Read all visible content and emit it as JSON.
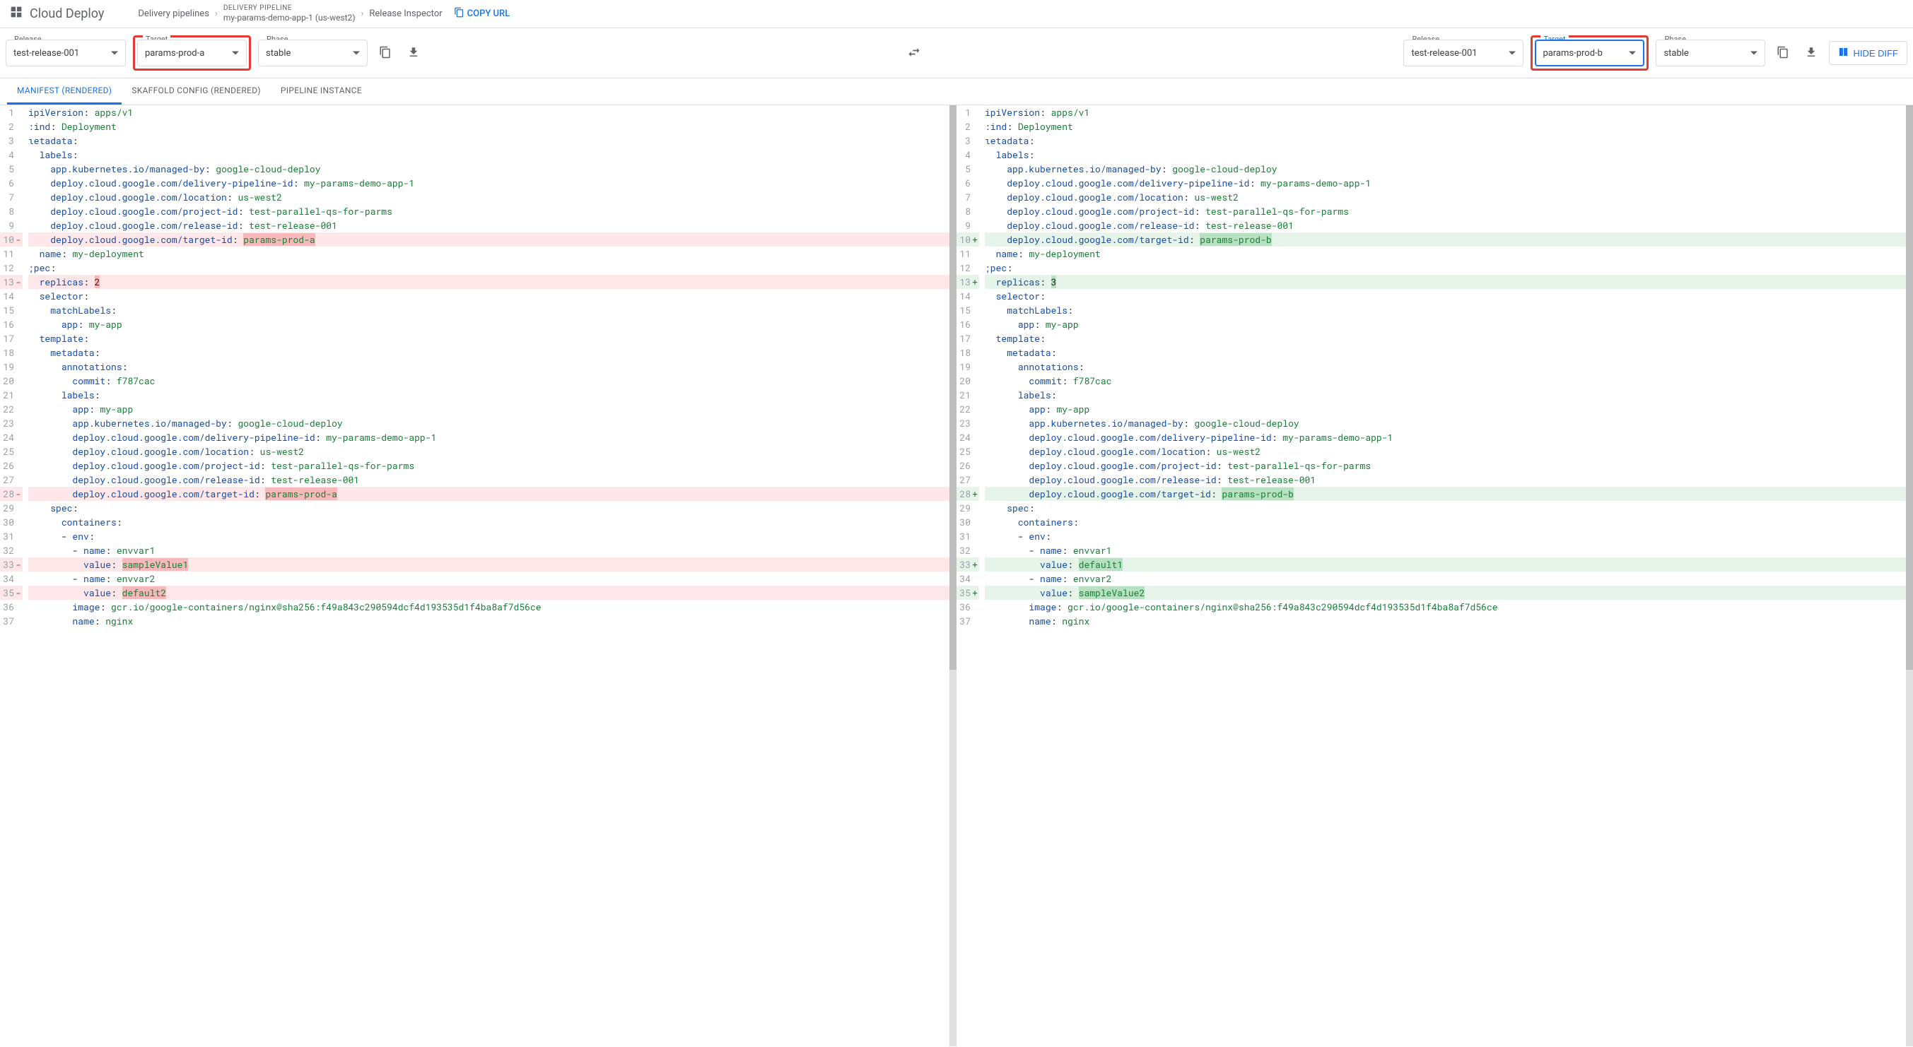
{
  "header": {
    "product": "Cloud Deploy",
    "crumb1": "Delivery pipelines",
    "pipeline_label": "DELIVERY PIPELINE",
    "pipeline_value": "my-params-demo-app-1 (us-west2)",
    "crumb3": "Release Inspector",
    "copy_url": "COPY URL"
  },
  "left_panel": {
    "release_label": "Release",
    "release_value": "test-release-001",
    "target_label": "Target",
    "target_value": "params-prod-a",
    "phase_label": "Phase",
    "phase_value": "stable"
  },
  "right_panel": {
    "release_label": "Release",
    "release_value": "test-release-001",
    "target_label": "Target",
    "target_value": "params-prod-b",
    "phase_label": "Phase",
    "phase_value": "stable"
  },
  "hide_diff": "HIDE DIFF",
  "tabs": {
    "t1": "MANIFEST (RENDERED)",
    "t2": "SKAFFOLD CONFIG (RENDERED)",
    "t3": "PIPELINE INSTANCE"
  },
  "code": {
    "left": [
      {
        "n": 1,
        "m": "",
        "html": "<span class='tok-key'>ipiVersion</span>: <span class='tok-str'>apps/v1</span>"
      },
      {
        "n": 2,
        "m": "",
        "html": "<span class='tok-key'>:ind</span>: <span class='tok-str'>Deployment</span>"
      },
      {
        "n": 3,
        "m": "",
        "html": "<span class='tok-key'>ιetadata</span>:"
      },
      {
        "n": 4,
        "m": "",
        "html": "  <span class='tok-key'>labels</span>:"
      },
      {
        "n": 5,
        "m": "",
        "html": "    <span class='tok-key'>app.kubernetes.io/managed-by</span>: <span class='tok-str'>google-cloud-deploy</span>"
      },
      {
        "n": 6,
        "m": "",
        "html": "    <span class='tok-key'>deploy.cloud.google.com/delivery-pipeline-id</span>: <span class='tok-str'>my-params-demo-app-1</span>"
      },
      {
        "n": 7,
        "m": "",
        "html": "    <span class='tok-key'>deploy.cloud.google.com/location</span>: <span class='tok-str'>us-west2</span>"
      },
      {
        "n": 8,
        "m": "",
        "html": "    <span class='tok-key'>deploy.cloud.google.com/project-id</span>: <span class='tok-str'>test-parallel-qs-for-parms</span>"
      },
      {
        "n": 9,
        "m": "",
        "html": "    <span class='tok-key'>deploy.cloud.google.com/release-id</span>: <span class='tok-str'>test-release-001</span>"
      },
      {
        "n": 10,
        "m": "-",
        "cls": "line-del",
        "html": "    <span class='tok-key'>deploy.cloud.google.com/target-id</span>: <span class='tok-str inline-del'>params-prod-a</span>"
      },
      {
        "n": 11,
        "m": "",
        "html": "  <span class='tok-key'>name</span>: <span class='tok-str'>my-deployment</span>"
      },
      {
        "n": 12,
        "m": "",
        "html": "<span class='tok-key'>;pec</span>:"
      },
      {
        "n": 13,
        "m": "-",
        "cls": "line-del",
        "html": "  <span class='tok-key'>replicas</span>: <span class='inline-del'>2</span>"
      },
      {
        "n": 14,
        "m": "",
        "html": "  <span class='tok-key'>selector</span>:"
      },
      {
        "n": 15,
        "m": "",
        "html": "    <span class='tok-key'>matchLabels</span>:"
      },
      {
        "n": 16,
        "m": "",
        "html": "      <span class='tok-key'>app</span>: <span class='tok-str'>my-app</span>"
      },
      {
        "n": 17,
        "m": "",
        "html": "  <span class='tok-key'>template</span>:"
      },
      {
        "n": 18,
        "m": "",
        "html": "    <span class='tok-key'>metadata</span>:"
      },
      {
        "n": 19,
        "m": "",
        "html": "      <span class='tok-key'>annotations</span>:"
      },
      {
        "n": 20,
        "m": "",
        "html": "        <span class='tok-key'>commit</span>: <span class='tok-str'>f787cac</span>"
      },
      {
        "n": 21,
        "m": "",
        "html": "      <span class='tok-key'>labels</span>:"
      },
      {
        "n": 22,
        "m": "",
        "html": "        <span class='tok-key'>app</span>: <span class='tok-str'>my-app</span>"
      },
      {
        "n": 23,
        "m": "",
        "html": "        <span class='tok-key'>app.kubernetes.io/managed-by</span>: <span class='tok-str'>google-cloud-deploy</span>"
      },
      {
        "n": 24,
        "m": "",
        "html": "        <span class='tok-key'>deploy.cloud.google.com/delivery-pipeline-id</span>: <span class='tok-str'>my-params-demo-app-1</span>"
      },
      {
        "n": 25,
        "m": "",
        "html": "        <span class='tok-key'>deploy.cloud.google.com/location</span>: <span class='tok-str'>us-west2</span>"
      },
      {
        "n": 26,
        "m": "",
        "html": "        <span class='tok-key'>deploy.cloud.google.com/project-id</span>: <span class='tok-str'>test-parallel-qs-for-parms</span>"
      },
      {
        "n": 27,
        "m": "",
        "html": "        <span class='tok-key'>deploy.cloud.google.com/release-id</span>: <span class='tok-str'>test-release-001</span>"
      },
      {
        "n": 28,
        "m": "-",
        "cls": "line-del",
        "html": "        <span class='tok-key'>deploy.cloud.google.com/target-id</span>: <span class='tok-str inline-del'>params-prod-a</span>"
      },
      {
        "n": 29,
        "m": "",
        "html": "    <span class='tok-key'>spec</span>:"
      },
      {
        "n": 30,
        "m": "",
        "html": "      <span class='tok-key'>containers</span>:"
      },
      {
        "n": 31,
        "m": "",
        "html": "      - <span class='tok-key'>env</span>:"
      },
      {
        "n": 32,
        "m": "",
        "html": "        - <span class='tok-key'>name</span>: <span class='tok-str'>envvar1</span>"
      },
      {
        "n": 33,
        "m": "-",
        "cls": "line-del",
        "html": "          <span class='tok-key'>value</span>: <span class='tok-str inline-del'>sampleValue1</span>"
      },
      {
        "n": 34,
        "m": "",
        "html": "        - <span class='tok-key'>name</span>: <span class='tok-str'>envvar2</span>"
      },
      {
        "n": 35,
        "m": "-",
        "cls": "line-del",
        "html": "          <span class='tok-key'>value</span>: <span class='tok-str inline-del'>default2</span>"
      },
      {
        "n": 36,
        "m": "",
        "html": "        <span class='tok-key'>image</span>: <span class='tok-str'>gcr.io/google-containers/nginx@sha256:f49a843c290594dcf4d193535d1f4ba8af7d56ce</span>"
      },
      {
        "n": 37,
        "m": "",
        "html": "        <span class='tok-key'>name</span>: <span class='tok-str'>nginx</span>"
      }
    ],
    "right": [
      {
        "n": 1,
        "m": "",
        "html": "<span class='tok-key'>ipiVersion</span>: <span class='tok-str'>apps/v1</span>"
      },
      {
        "n": 2,
        "m": "",
        "html": "<span class='tok-key'>:ind</span>: <span class='tok-str'>Deployment</span>"
      },
      {
        "n": 3,
        "m": "",
        "html": "<span class='tok-key'>ιetadata</span>:"
      },
      {
        "n": 4,
        "m": "",
        "html": "  <span class='tok-key'>labels</span>:"
      },
      {
        "n": 5,
        "m": "",
        "html": "    <span class='tok-key'>app.kubernetes.io/managed-by</span>: <span class='tok-str'>google-cloud-deploy</span>"
      },
      {
        "n": 6,
        "m": "",
        "html": "    <span class='tok-key'>deploy.cloud.google.com/delivery-pipeline-id</span>: <span class='tok-str'>my-params-demo-app-1</span>"
      },
      {
        "n": 7,
        "m": "",
        "html": "    <span class='tok-key'>deploy.cloud.google.com/location</span>: <span class='tok-str'>us-west2</span>"
      },
      {
        "n": 8,
        "m": "",
        "html": "    <span class='tok-key'>deploy.cloud.google.com/project-id</span>: <span class='tok-str'>test-parallel-qs-for-parms</span>"
      },
      {
        "n": 9,
        "m": "",
        "html": "    <span class='tok-key'>deploy.cloud.google.com/release-id</span>: <span class='tok-str'>test-release-001</span>"
      },
      {
        "n": 10,
        "m": "+",
        "cls": "line-add",
        "html": "    <span class='tok-key'>deploy.cloud.google.com/target-id</span>: <span class='tok-str inline-add'>params-prod-b</span>"
      },
      {
        "n": 11,
        "m": "",
        "html": "  <span class='tok-key'>name</span>: <span class='tok-str'>my-deployment</span>"
      },
      {
        "n": 12,
        "m": "",
        "html": "<span class='tok-key'>;pec</span>:"
      },
      {
        "n": 13,
        "m": "+",
        "cls": "line-add",
        "html": "  <span class='tok-key'>replicas</span>: <span class='inline-add'>3</span>"
      },
      {
        "n": 14,
        "m": "",
        "html": "  <span class='tok-key'>selector</span>:"
      },
      {
        "n": 15,
        "m": "",
        "html": "    <span class='tok-key'>matchLabels</span>:"
      },
      {
        "n": 16,
        "m": "",
        "html": "      <span class='tok-key'>app</span>: <span class='tok-str'>my-app</span>"
      },
      {
        "n": 17,
        "m": "",
        "html": "  <span class='tok-key'>template</span>:"
      },
      {
        "n": 18,
        "m": "",
        "html": "    <span class='tok-key'>metadata</span>:"
      },
      {
        "n": 19,
        "m": "",
        "html": "      <span class='tok-key'>annotations</span>:"
      },
      {
        "n": 20,
        "m": "",
        "html": "        <span class='tok-key'>commit</span>: <span class='tok-str'>f787cac</span>"
      },
      {
        "n": 21,
        "m": "",
        "html": "      <span class='tok-key'>labels</span>:"
      },
      {
        "n": 22,
        "m": "",
        "html": "        <span class='tok-key'>app</span>: <span class='tok-str'>my-app</span>"
      },
      {
        "n": 23,
        "m": "",
        "html": "        <span class='tok-key'>app.kubernetes.io/managed-by</span>: <span class='tok-str'>google-cloud-deploy</span>"
      },
      {
        "n": 24,
        "m": "",
        "html": "        <span class='tok-key'>deploy.cloud.google.com/delivery-pipeline-id</span>: <span class='tok-str'>my-params-demo-app-1</span>"
      },
      {
        "n": 25,
        "m": "",
        "html": "        <span class='tok-key'>deploy.cloud.google.com/location</span>: <span class='tok-str'>us-west2</span>"
      },
      {
        "n": 26,
        "m": "",
        "html": "        <span class='tok-key'>deploy.cloud.google.com/project-id</span>: <span class='tok-str'>test-parallel-qs-for-parms</span>"
      },
      {
        "n": 27,
        "m": "",
        "html": "        <span class='tok-key'>deploy.cloud.google.com/release-id</span>: <span class='tok-str'>test-release-001</span>"
      },
      {
        "n": 28,
        "m": "+",
        "cls": "line-add",
        "html": "        <span class='tok-key'>deploy.cloud.google.com/target-id</span>: <span class='tok-str inline-add'>params-prod-b</span>"
      },
      {
        "n": 29,
        "m": "",
        "html": "    <span class='tok-key'>spec</span>:"
      },
      {
        "n": 30,
        "m": "",
        "html": "      <span class='tok-key'>containers</span>:"
      },
      {
        "n": 31,
        "m": "",
        "html": "      - <span class='tok-key'>env</span>:"
      },
      {
        "n": 32,
        "m": "",
        "html": "        - <span class='tok-key'>name</span>: <span class='tok-str'>envvar1</span>"
      },
      {
        "n": 33,
        "m": "+",
        "cls": "line-add",
        "html": "          <span class='tok-key'>value</span>: <span class='tok-str inline-add'>default1</span>"
      },
      {
        "n": 34,
        "m": "",
        "html": "        - <span class='tok-key'>name</span>: <span class='tok-str'>envvar2</span>"
      },
      {
        "n": 35,
        "m": "+",
        "cls": "line-add",
        "html": "          <span class='tok-key'>value</span>: <span class='tok-str inline-add'>sampleValue2</span>"
      },
      {
        "n": 36,
        "m": "",
        "html": "        <span class='tok-key'>image</span>: <span class='tok-str'>gcr.io/google-containers/nginx@sha256:f49a843c290594dcf4d193535d1f4ba8af7d56ce</span>"
      },
      {
        "n": 37,
        "m": "",
        "html": "        <span class='tok-key'>name</span>: <span class='tok-str'>nginx</span>"
      }
    ]
  }
}
